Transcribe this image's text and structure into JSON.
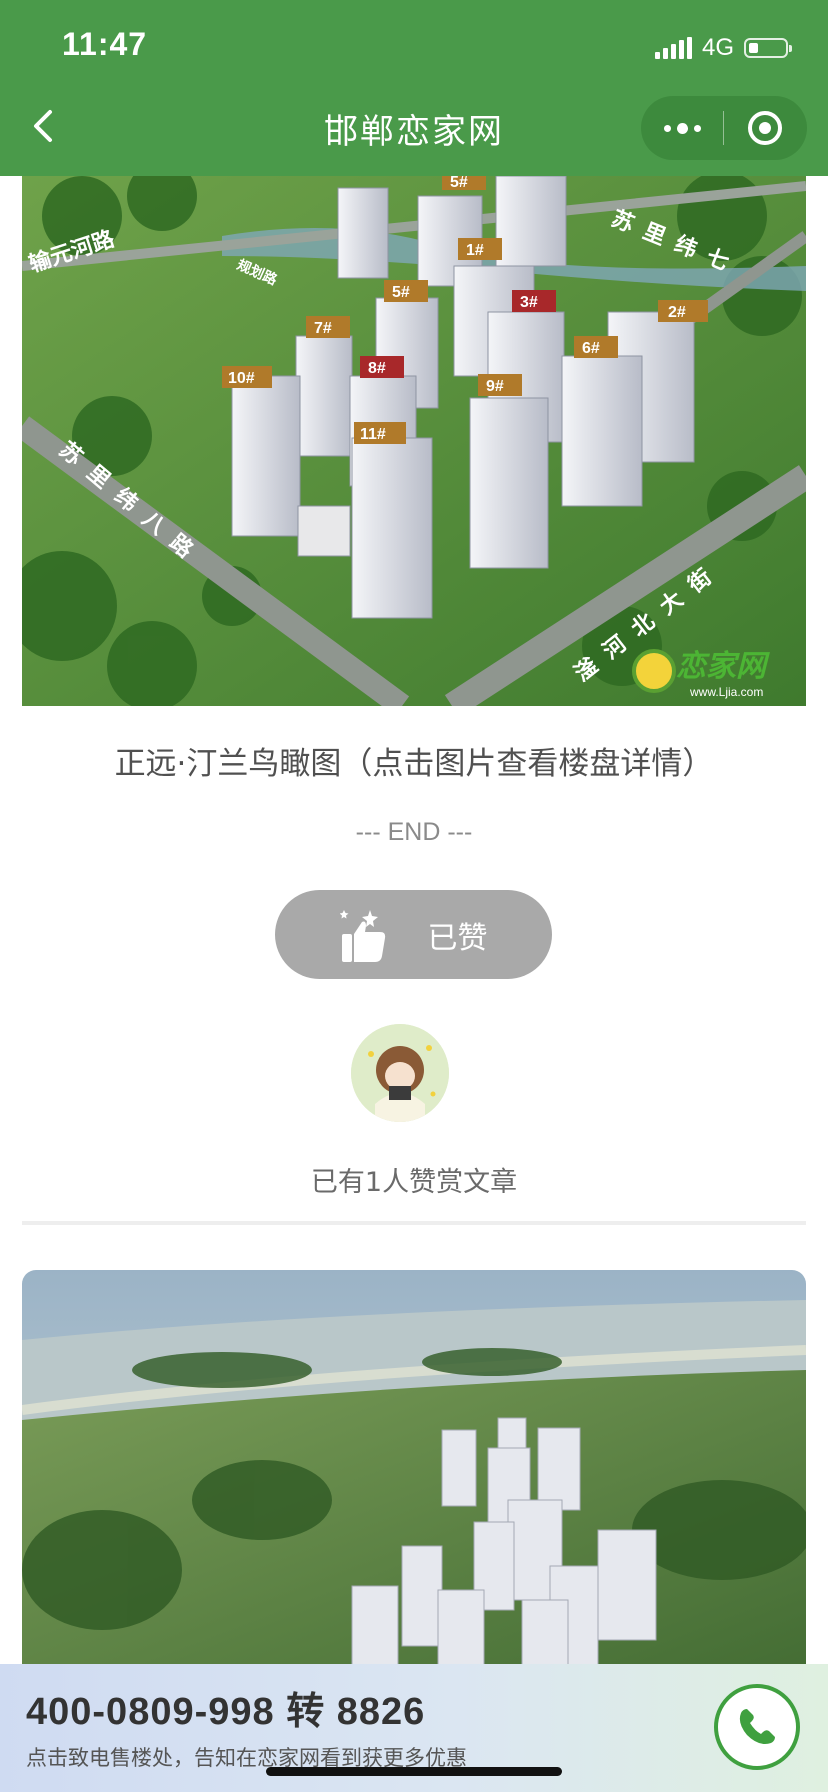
{
  "status_bar": {
    "time": "11:47",
    "network": "4G"
  },
  "nav": {
    "title": "邯郸恋家网"
  },
  "hero": {
    "road_labels": [
      "输元河路",
      "规划路",
      "苏里纬七",
      "苏里纬八路",
      "滏河北大街"
    ],
    "building_labels": [
      "5#",
      "1#",
      "5#",
      "3#",
      "2#",
      "7#",
      "6#",
      "8#",
      "10#",
      "9#",
      "11#"
    ],
    "watermark": "恋家网",
    "watermark_url": "www.Ljia.com"
  },
  "article": {
    "caption": "正远·汀兰鸟瞰图（点击图片查看楼盘详情）",
    "end_text": "--- END ---",
    "like_label": "已赞",
    "likes_text": "已有1人赞赏文章"
  },
  "call_bar": {
    "phone": "400-0809-998 转 8826",
    "hint": "点击致电售楼处，告知在恋家网看到获更多优惠"
  },
  "colors": {
    "brand_green": "#4a9a4a",
    "like_gray": "#a9a9a9"
  }
}
